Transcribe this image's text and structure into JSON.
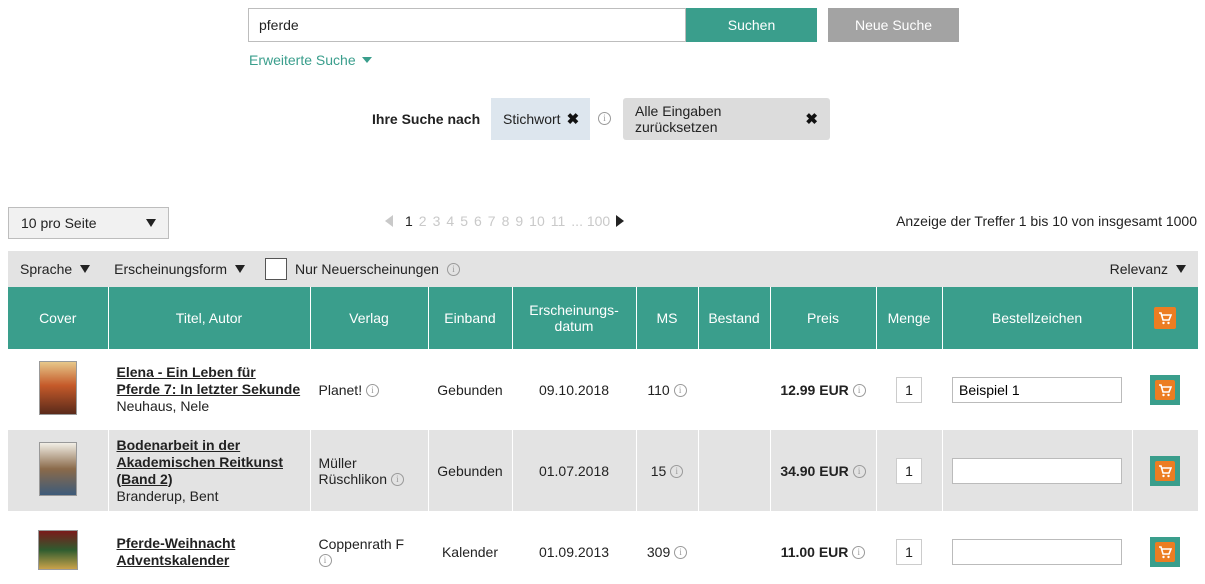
{
  "search": {
    "value": "pferde",
    "search_button": "Suchen",
    "new_search_button": "Neue Suche",
    "advanced_link": "Erweiterte Suche"
  },
  "filters": {
    "label": "Ihre Suche nach",
    "keyword_chip": "Stichwort",
    "reset_chip": "Alle Eingaben zurücksetzen"
  },
  "paging": {
    "per_page": "10 pro Seite",
    "pages": [
      "1",
      "2",
      "3",
      "4",
      "5",
      "6",
      "7",
      "8",
      "9",
      "10",
      "11",
      "... 100"
    ],
    "current_page": "1",
    "hits_text": "Anzeige der Treffer 1 bis 10 von insgesamt 1000"
  },
  "filterbar": {
    "language": "Sprache",
    "format": "Erscheinungsform",
    "new_only": "Nur Neuerscheinungen",
    "sort": "Relevanz"
  },
  "table": {
    "headers": {
      "cover": "Cover",
      "title": "Titel, Autor",
      "publisher": "Verlag",
      "binding": "Einband",
      "date": "Erscheinungs-\ndatum",
      "ms": "MS",
      "stock": "Bestand",
      "price": "Preis",
      "qty": "Menge",
      "order_ref": "Bestellzeichen"
    },
    "rows": [
      {
        "title": "Elena - Ein Leben für Pferde 7: In letzter Sekunde",
        "author": "Neuhaus, Nele",
        "publisher": "Planet!",
        "binding": "Gebunden",
        "date": "09.10.2018",
        "ms": "110",
        "price": "12.99 EUR",
        "qty": "1",
        "order_ref": "Beispiel 1"
      },
      {
        "title": "Bodenarbeit in der Akademischen Reitkunst (Band 2)",
        "author": "Branderup, Bent",
        "publisher": "Müller Rüschlikon",
        "binding": "Gebunden",
        "date": "01.07.2018",
        "ms": "15",
        "price": "34.90 EUR",
        "qty": "1",
        "order_ref": ""
      },
      {
        "title": "Pferde-Weihnacht Adventskalender",
        "author": "",
        "publisher": "Coppenrath F",
        "binding": "Kalender",
        "date": "01.09.2013",
        "ms": "309",
        "price": "11.00 EUR",
        "qty": "1",
        "order_ref": ""
      }
    ]
  },
  "colors": {
    "teal": "#3a9e8c",
    "grey_button": "#a3a3a3",
    "cart_orange": "#ec7d22",
    "row_alt": "#e3e3e3"
  }
}
